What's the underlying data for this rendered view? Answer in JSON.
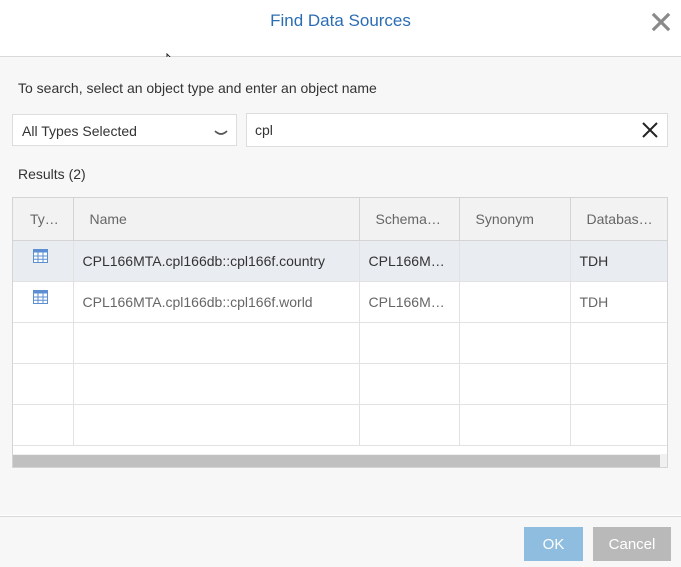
{
  "dialog": {
    "title": "Find Data Sources"
  },
  "instruction": "To search, select an object type and enter an object name",
  "type_select": {
    "value": "All Types Selected"
  },
  "search": {
    "value": "cpl"
  },
  "results_label": "Results (2)",
  "grid": {
    "columns": [
      "Typ…",
      "Name",
      "Schema…",
      "Synonym",
      "Database…"
    ],
    "rows": [
      {
        "name": "CPL166MTA.cpl166db::cpl166f.country",
        "schema": "CPL166M…",
        "synonym": "",
        "database": "TDH",
        "icon": "table-icon",
        "selected": true
      },
      {
        "name": "CPL166MTA.cpl166db::cpl166f.world",
        "schema": "CPL166M…",
        "synonym": "",
        "database": "TDH",
        "icon": "table-icon",
        "selected": false
      }
    ]
  },
  "footer": {
    "ok_label": "OK",
    "cancel_label": "Cancel"
  },
  "colors": {
    "title": "#2b6db3",
    "ok_button": "#8fbde0",
    "cancel_button": "#b9b9b9",
    "selected_row": "#e9edf2"
  }
}
